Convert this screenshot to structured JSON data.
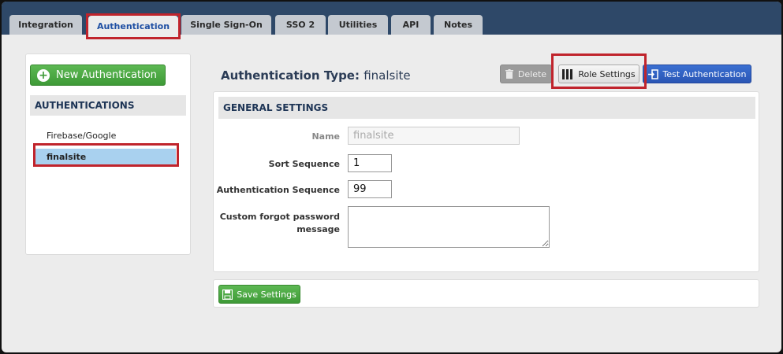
{
  "tabs": [
    {
      "label": "Integration"
    },
    {
      "label": "Authentication"
    },
    {
      "label": "Single Sign-On"
    },
    {
      "label": "SSO 2"
    },
    {
      "label": "Utilities"
    },
    {
      "label": "API"
    },
    {
      "label": "Notes"
    }
  ],
  "sidebar": {
    "new_button": "New Authentication",
    "header": "AUTHENTICATIONS",
    "items": [
      {
        "label": "Firebase/Google"
      },
      {
        "label": "finalsite"
      }
    ]
  },
  "page": {
    "title_prefix": "Authentication Type:",
    "title_value": "finalsite"
  },
  "toolbar": {
    "delete_label": "Delete",
    "role_settings_label": "Role Settings",
    "test_auth_label": "Test Authentication"
  },
  "general": {
    "header": "GENERAL SETTINGS",
    "name_label": "Name",
    "name_value": "finalsite",
    "sort_label": "Sort Sequence",
    "sort_value": "1",
    "auth_seq_label": "Authentication Sequence",
    "auth_seq_value": "99",
    "forgot_label": "Custom forgot password message",
    "forgot_value": ""
  },
  "save_label": "Save Settings",
  "colors": {
    "navbar": "#2e4868",
    "highlight_border": "#c0242c",
    "primary_green": "#3e9a37",
    "primary_blue": "#2a56b5",
    "selected_row": "#a9d1ef"
  }
}
